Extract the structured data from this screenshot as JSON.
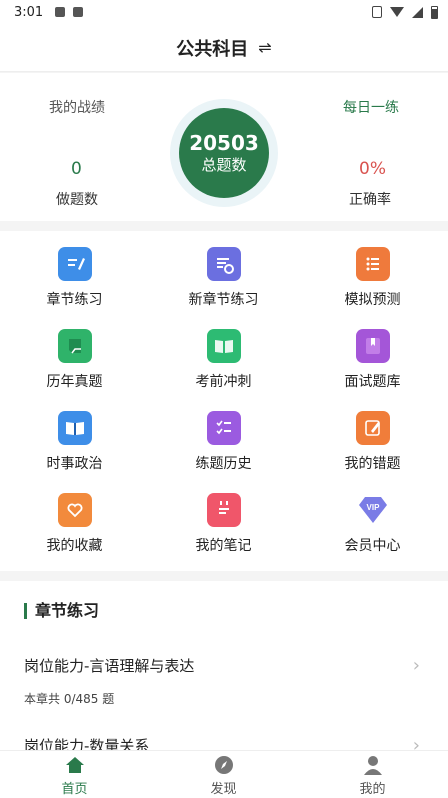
{
  "status_bar": {
    "time": "3:01"
  },
  "header": {
    "title": "公共科目",
    "switch_icon": "⇌"
  },
  "stats": {
    "my_record_label": "我的战绩",
    "daily_practice_label": "每日一练",
    "total_count": "20503",
    "total_label": "总题数",
    "done_count": "0",
    "done_label": "做题数",
    "accuracy": "0%",
    "accuracy_label": "正确率"
  },
  "menu": {
    "items": [
      {
        "label": "章节练习",
        "icon": "edit-doc-icon",
        "color": "#3e8ee8"
      },
      {
        "label": "新章节练习",
        "icon": "list-gear-icon",
        "color": "#6b6fe0"
      },
      {
        "label": "模拟预测",
        "icon": "checklist-icon",
        "color": "#ef7a3c"
      },
      {
        "label": "历年真题",
        "icon": "notebook-icon",
        "color": "#2fb36a"
      },
      {
        "label": "考前冲刺",
        "icon": "open-book-icon",
        "color": "#2dbb73"
      },
      {
        "label": "面试题库",
        "icon": "bookmark-book-icon",
        "color": "#a456d8"
      },
      {
        "label": "时事政治",
        "icon": "reading-book-icon",
        "color": "#3e8ee8"
      },
      {
        "label": "练题历史",
        "icon": "task-list-icon",
        "color": "#9b5be0"
      },
      {
        "label": "我的错题",
        "icon": "pencil-note-icon",
        "color": "#f07d3a"
      },
      {
        "label": "我的收藏",
        "icon": "heart-folder-icon",
        "color": "#f28a3c"
      },
      {
        "label": "我的笔记",
        "icon": "calendar-note-icon",
        "color": "#f0566a"
      },
      {
        "label": "会员中心",
        "icon": "vip-diamond-icon",
        "color": "#7a7ce6"
      }
    ]
  },
  "chapters": {
    "section_title": "章节练习",
    "items": [
      {
        "name": "岗位能力-言语理解与表达",
        "count": "本章共 0/485 题"
      },
      {
        "name": "岗位能力-数量关系",
        "count": ""
      }
    ]
  },
  "tabbar": {
    "active_color": "#2a7a4b",
    "tabs": [
      {
        "label": "首页",
        "icon": "home-icon"
      },
      {
        "label": "发现",
        "icon": "compass-icon"
      },
      {
        "label": "我的",
        "icon": "user-icon"
      }
    ]
  }
}
